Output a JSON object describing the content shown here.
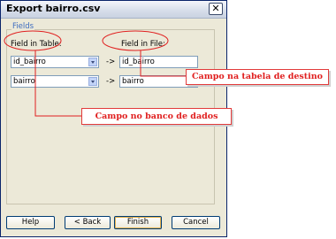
{
  "window": {
    "title": "Export bairro.csv",
    "close_glyph": "✕"
  },
  "group": {
    "label": "Fields"
  },
  "headers": {
    "field_in_table": "Field in Table:",
    "field_in_file": "Field in File:"
  },
  "rows": [
    {
      "table_field": "id_bairro",
      "arrow": "->",
      "file_field": "id_bairro"
    },
    {
      "table_field": "bairro",
      "arrow": "->",
      "file_field": "bairro"
    }
  ],
  "buttons": {
    "help": "Help",
    "back": "< Back",
    "finish": "Finish",
    "cancel": "Cancel"
  },
  "annotations": {
    "destination": "Campo na tabela de destino",
    "database": "Campo no banco de dados",
    "color": "#e02020"
  }
}
